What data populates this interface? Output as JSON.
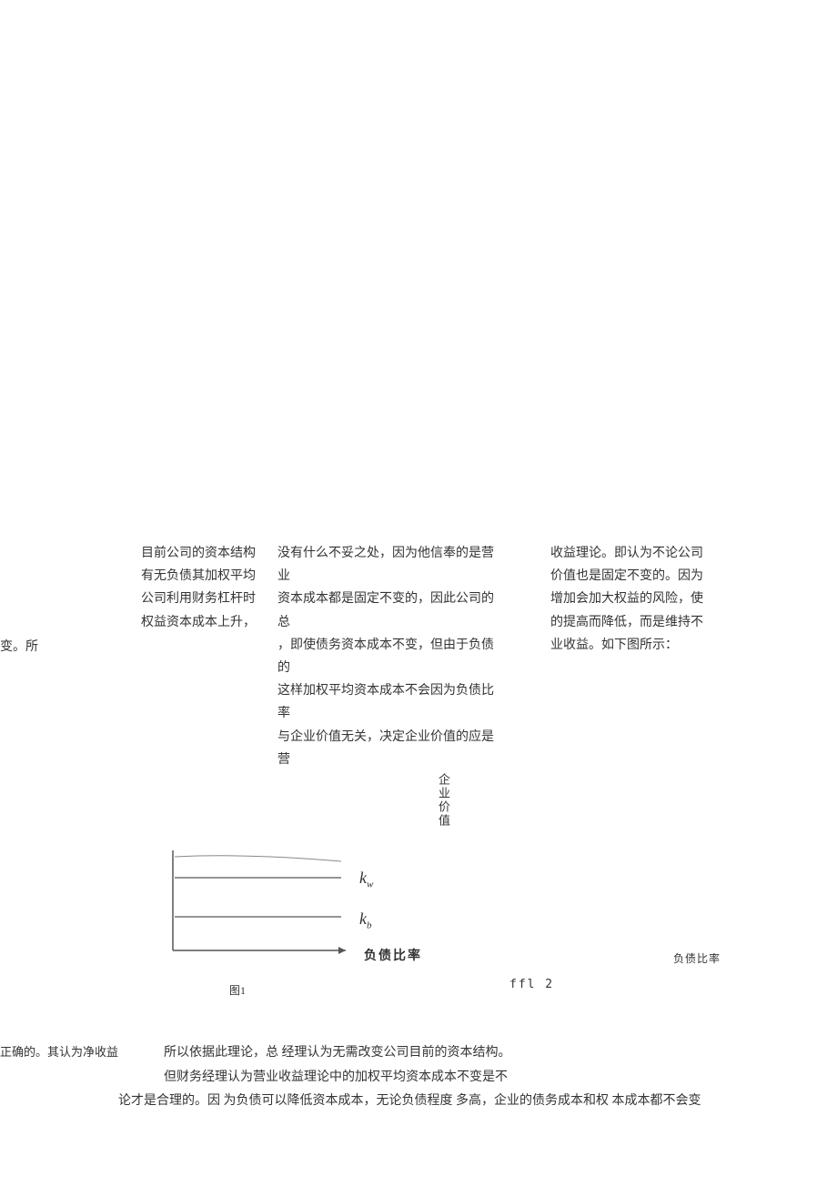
{
  "para1": {
    "colA_l1": "目前公司的资本结构",
    "colA_l2": "有无负债其加权平均",
    "colA_l3": "公司利用财务杠杆时",
    "colA_l4": "权益资本成本上升，",
    "colB_l1": "没有什么不妥之处，因为他信奉的是营业",
    "colB_l2": "资本成本都是固定不变的，因此公司的总",
    "colB_l3": "，即使债务资本成本不变，但由于负债的",
    "colB_l4": "这样加权平均资本成本不会因为负债比率",
    "colB_l5": "与企业价值无关，决定企业价值的应是营",
    "colC_l1": "收益理论。即认为不论公司",
    "colC_l2": "价值也是固定不变的。因为",
    "colC_l3": "增加会加大权益的风险，使",
    "colC_l4": "的提高而降低，而是维持不",
    "colC_l5": "业收益。如下图所示："
  },
  "leftMargin": "变。所",
  "verticalLabel": "企业价值",
  "chart_data": {
    "type": "line",
    "series": [
      {
        "name": "k_w",
        "description": "加权平均资本成本，横线，随负债比率不变"
      },
      {
        "name": "k_b",
        "description": "债务资本成本，横线，位置低于k_w，随负债比率不变"
      }
    ],
    "xlabel": "负债比率",
    "ylabel": "",
    "title": ""
  },
  "labels": {
    "kw_main": "k",
    "kw_sub": "w",
    "kb_main": "k",
    "kb_sub": "b",
    "xlabel": "负债比率",
    "rightXlabel": "负债比率",
    "fig1": "图1",
    "fig2": "ffl 2"
  },
  "bottom": {
    "leftText": "正确的。其认为净收益",
    "r1": "所以依据此理论，总 经理认为无需改变公司目前的资本结构。",
    "r2": "但财务经理认为营业收益理论中的加权平均资本成本不变是不",
    "r3": "论才是合理的。因 为负债可以降低资本成本，无论负债程度 多高，企业的债务成本和权 本成本都不会变"
  }
}
